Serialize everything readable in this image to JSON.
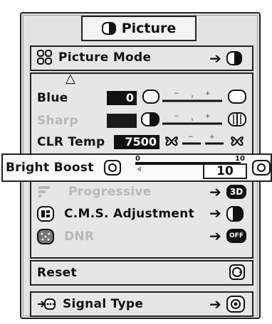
{
  "menu": {
    "title": "Picture",
    "picture_mode_label": "Picture Mode",
    "items": {
      "blue": {
        "label": "Blue",
        "value": "0",
        "min_mark": "−",
        "max_mark": "+"
      },
      "sharp": {
        "label": "Sharp",
        "min_mark": "−",
        "max_mark": "+"
      },
      "clr_temp": {
        "label": "CLR Temp",
        "value": "7500",
        "min_mark": "−",
        "max_mark": "+"
      },
      "bright_boost": {
        "label": "Bright Boost",
        "value": "10",
        "min": "0",
        "max": "10",
        "level": 1.0
      },
      "progressive": {
        "label": "Progressive"
      },
      "cms": {
        "label": "C.M.S. Adjustment"
      },
      "dnr": {
        "label": "DNR"
      },
      "reset": {
        "label": "Reset"
      },
      "signal_type": {
        "label": "Signal Type"
      }
    },
    "arrow_glyph": "➔",
    "up_glyph": "△",
    "enter_glyph": "➡"
  },
  "icons": {
    "title": "picture-icon",
    "picture_mode": "picture-mode-icon",
    "progressive": "progressive-icon",
    "cms": "cms-icon",
    "dnr": "dnr-icon",
    "signal_type": "signal-type-icon",
    "badge_3d": "3D",
    "badge_off": "OFF"
  }
}
